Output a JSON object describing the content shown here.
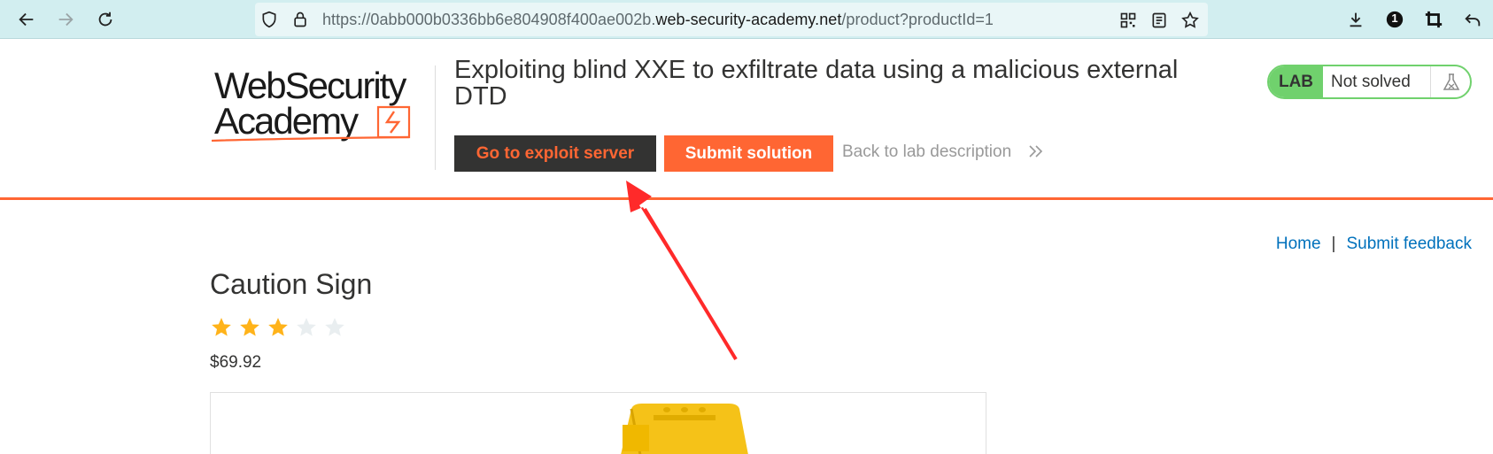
{
  "browser": {
    "url_prefix": "https://0abb000b0336bb6e804908f400ae002b.",
    "url_domain": "web-security-academy.net",
    "url_path": "/product?productId=1",
    "extension_badge": "1"
  },
  "header": {
    "logo_line1": "WebSecurity",
    "logo_line2": "Academy",
    "lab_title": "Exploiting blind XXE to exfiltrate data using a malicious external DTD",
    "exploit_button": "Go to exploit server",
    "submit_button": "Submit solution",
    "back_link": "Back to lab description",
    "lab_tag": "LAB",
    "lab_status": "Not solved",
    "accent_color": "#ff6633",
    "status_color": "#70d16d"
  },
  "nav": {
    "home": "Home",
    "separator": "|",
    "feedback": "Submit feedback"
  },
  "product": {
    "title": "Caution Sign",
    "rating": 3,
    "rating_max": 5,
    "price": "$69.92"
  },
  "annotation": {
    "type": "arrow",
    "color": "#ff2a2a",
    "points_to": "exploit_button"
  }
}
